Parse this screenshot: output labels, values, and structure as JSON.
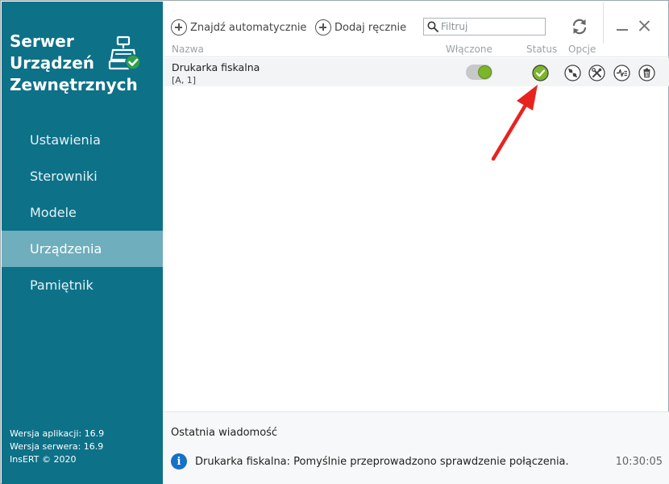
{
  "sidebar": {
    "title_lines": [
      "Serwer",
      "Urządzeń",
      "Zewnętrznych"
    ],
    "logo_icon": "cash-register-check-icon",
    "items": [
      {
        "label": "Ustawienia",
        "active": false
      },
      {
        "label": "Sterowniki",
        "active": false
      },
      {
        "label": "Modele",
        "active": false
      },
      {
        "label": "Urządzenia",
        "active": true
      },
      {
        "label": "Pamiętnik",
        "active": false
      }
    ],
    "version": {
      "app": "Wersja aplikacji: 16.9",
      "server": "Wersja serwera: 16.9",
      "copyright": "InsERT © 2020"
    },
    "colors": {
      "background": "#0d7188",
      "active": "#6eaebd"
    }
  },
  "toolbar": {
    "find_auto_label": "Znajdź automatycznie",
    "add_manual_label": "Dodaj ręcznie",
    "filter_placeholder": "Filtruj",
    "refresh_icon": "refresh-icon",
    "minimize_icon": "minimize-icon",
    "close_icon": "close-icon"
  },
  "table": {
    "columns": {
      "name": "Nazwa",
      "enabled": "Włączone",
      "status": "Status",
      "options": "Opcje"
    },
    "rows": [
      {
        "name": "Drukarka fiskalna",
        "sub": "[A, 1]",
        "enabled": true,
        "status": "ok",
        "options": [
          "test-connection-icon",
          "settings-tools-icon",
          "diagnostics-icon",
          "delete-icon"
        ]
      }
    ]
  },
  "bottom": {
    "title": "Ostatnia wiadomość",
    "message": "Drukarka fiskalna: Pomyślnie przeprowadzono sprawdzenie połączenia.",
    "time": "10:30:05"
  },
  "colors": {
    "accent_green": "#7db52b",
    "info_blue": "#1570c8",
    "annotation_red": "#e8231f"
  }
}
